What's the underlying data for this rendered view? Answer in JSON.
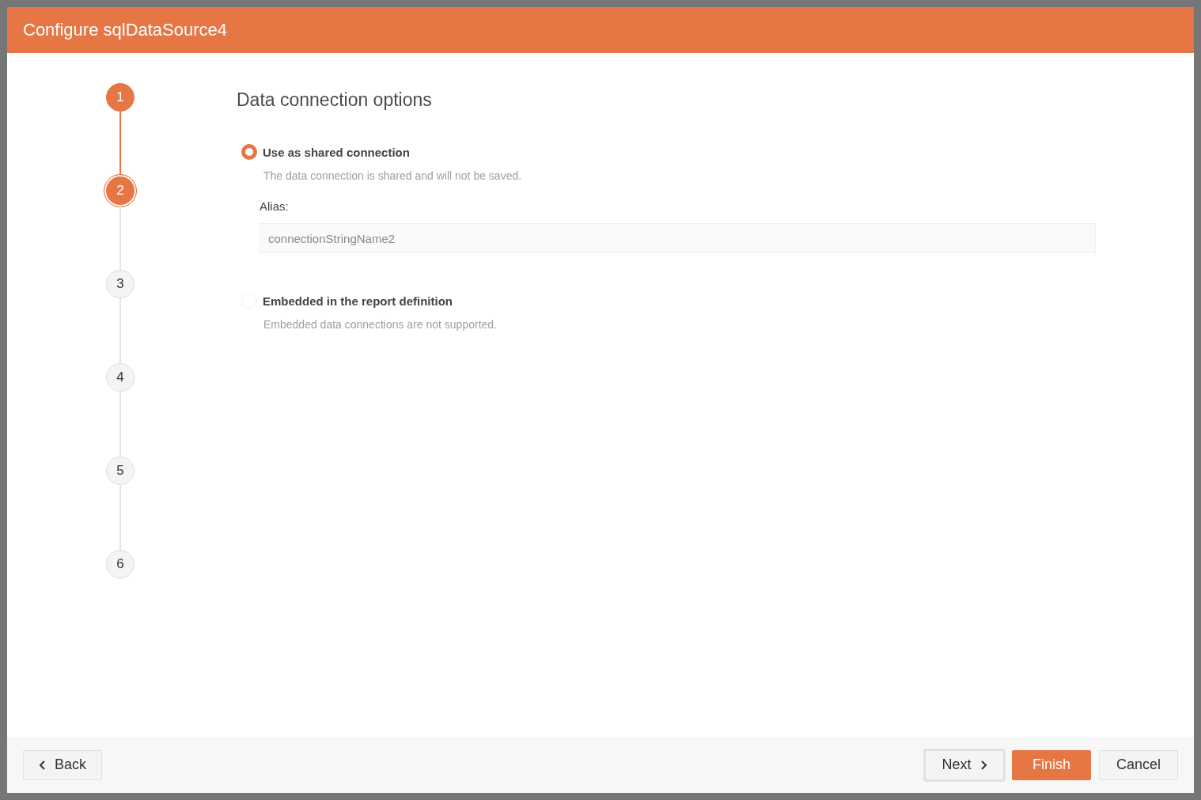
{
  "dialog": {
    "title": "Configure sqlDataSource4"
  },
  "steps": [
    {
      "label": "1",
      "completed": true,
      "selected": false
    },
    {
      "label": "2",
      "completed": true,
      "selected": true
    },
    {
      "label": "3",
      "completed": false,
      "selected": false
    },
    {
      "label": "4",
      "completed": false,
      "selected": false
    },
    {
      "label": "5",
      "completed": false,
      "selected": false
    },
    {
      "label": "6",
      "completed": false,
      "selected": false
    }
  ],
  "page": {
    "heading": "Data connection options",
    "options": [
      {
        "label": "Use as shared connection",
        "description": "The data connection is shared and will not be saved.",
        "selected": true,
        "disabled": false,
        "alias": {
          "label": "Alias:",
          "value": "connectionStringName2"
        }
      },
      {
        "label": "Embedded in the report definition",
        "description": "Embedded data connections are not supported.",
        "selected": false,
        "disabled": true
      }
    ]
  },
  "footer": {
    "buttons": [
      {
        "label": "Back",
        "kind": "back"
      },
      {
        "label": "Next",
        "kind": "next"
      },
      {
        "label": "Finish",
        "kind": "primary"
      },
      {
        "label": "Cancel",
        "kind": "plain"
      }
    ]
  }
}
